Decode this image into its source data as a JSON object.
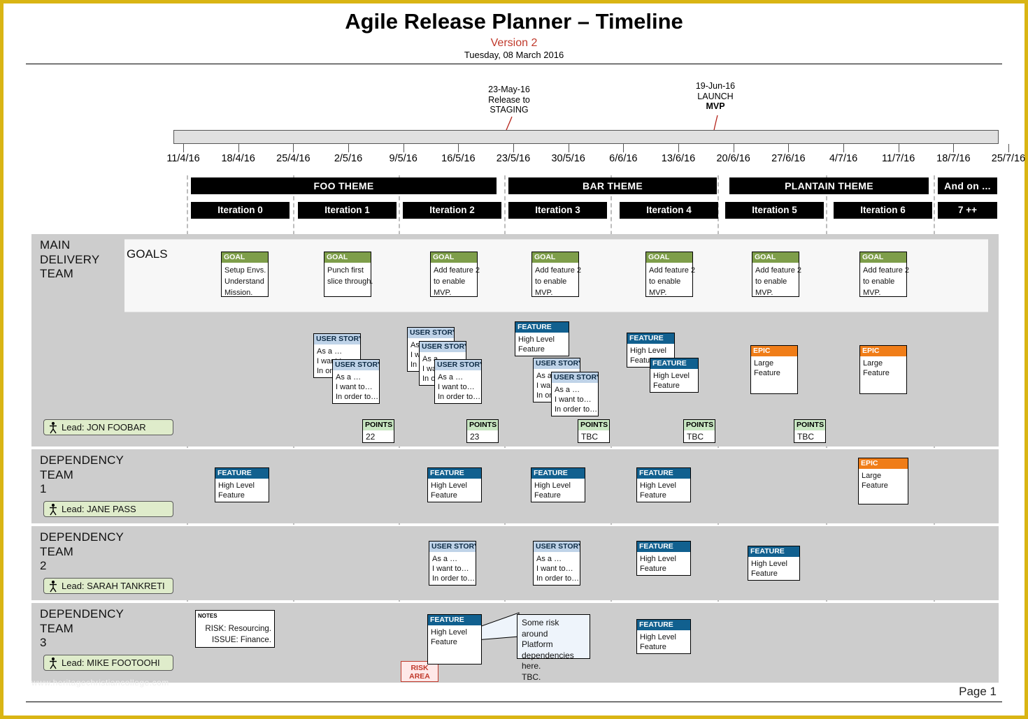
{
  "document": {
    "title": "Agile Release Planner – Timeline",
    "version": "Version 2",
    "date": "Tuesday, 08 March 2016",
    "page_label": "Page 1",
    "watermark": "www.heritagechristiancollege.com"
  },
  "milestones": [
    {
      "date": "23-May-16",
      "line2": "Release to",
      "line3": "STAGING",
      "marker": "arrow",
      "color": "#b5231a"
    },
    {
      "date": "19-Jun-16",
      "line2": "LAUNCH",
      "line3": "MVP",
      "marker": "cross",
      "color": "#b5231a"
    }
  ],
  "axis": {
    "ticks": [
      "11/4/16",
      "18/4/16",
      "25/4/16",
      "2/5/16",
      "9/5/16",
      "16/5/16",
      "23/5/16",
      "30/5/16",
      "6/6/16",
      "13/6/16",
      "20/6/16",
      "27/6/16",
      "4/7/16",
      "11/7/16",
      "18/7/16",
      "25/7/16"
    ]
  },
  "themes": [
    {
      "label": "FOO THEME"
    },
    {
      "label": "BAR THEME"
    },
    {
      "label": "PLANTAIN THEME"
    },
    {
      "label": "And on ..."
    }
  ],
  "iterations": [
    {
      "label": "Iteration 0"
    },
    {
      "label": "Iteration 1"
    },
    {
      "label": "Iteration 2"
    },
    {
      "label": "Iteration 3"
    },
    {
      "label": "Iteration 4"
    },
    {
      "label": "Iteration 5"
    },
    {
      "label": "Iteration 6"
    },
    {
      "label": "7 ++"
    }
  ],
  "lanes": [
    {
      "name": "MAIN\nDELIVERY\nTEAM",
      "line1": "MAIN",
      "line2": "DELIVERY",
      "line3": "TEAM",
      "lead": "Lead: JON FOOBAR"
    },
    {
      "name": "DEPENDENCY TEAM 1",
      "line1": "DEPENDENCY",
      "line2": "TEAM",
      "line3": "1",
      "lead": "Lead: JANE PASS"
    },
    {
      "name": "DEPENDENCY TEAM 2",
      "line1": "DEPENDENCY",
      "line2": "TEAM",
      "line3": "2",
      "lead": "Lead: SARAH TANKRETI"
    },
    {
      "name": "DEPENDENCY TEAM 3",
      "line1": "DEPENDENCY",
      "line2": "TEAM",
      "line3": "3",
      "lead": "Lead: MIKE FOOTOOHI"
    }
  ],
  "goals_label": "GOALS",
  "goals": [
    {
      "head": "GOAL",
      "lines": [
        "Setup Envs.",
        "Understand",
        "Mission."
      ]
    },
    {
      "head": "GOAL",
      "lines": [
        "Punch first",
        "slice through."
      ]
    },
    {
      "head": "GOAL",
      "lines": [
        "Add feature 2",
        "to enable",
        "MVP."
      ]
    },
    {
      "head": "GOAL",
      "lines": [
        "Add feature 2",
        "to enable",
        "MVP."
      ]
    },
    {
      "head": "GOAL",
      "lines": [
        "Add feature 2",
        "to enable",
        "MVP."
      ]
    },
    {
      "head": "GOAL",
      "lines": [
        "Add feature 2",
        "to enable",
        "MVP."
      ]
    },
    {
      "head": "GOAL",
      "lines": [
        "Add feature 2",
        "to enable",
        "MVP."
      ]
    }
  ],
  "card_heads": {
    "story": "USER STORY",
    "feature": "FEATURE",
    "epic": "EPIC",
    "points": "POINTS",
    "notes": "NOTES",
    "goal": "GOAL"
  },
  "card_bodies": {
    "story": [
      "As a …",
      "I want to…",
      "In order to…"
    ],
    "feature": [
      "High Level",
      "Feature"
    ],
    "epic": [
      "Large",
      "Feature"
    ]
  },
  "main_team_cards": [
    {
      "type": "story",
      "head": "USER STORY",
      "lines": [
        "As a …",
        "I want to…",
        "In order to…"
      ]
    },
    {
      "type": "story",
      "head": "USER STORY",
      "lines": [
        "As a …",
        "I want to…",
        "In order to…"
      ]
    },
    {
      "type": "story",
      "head": "USER STORY",
      "lines": [
        "As a …",
        "I want to…",
        "In order to…"
      ]
    },
    {
      "type": "story",
      "head": "USER STORY",
      "lines": [
        "As a …",
        "I want to…",
        "In order to…"
      ]
    },
    {
      "type": "story",
      "head": "USER STORY",
      "lines": [
        "As a …",
        "I want to…",
        "In order to…"
      ]
    },
    {
      "type": "feature",
      "head": "FEATURE",
      "lines": [
        "High Level",
        "Feature"
      ]
    },
    {
      "type": "story",
      "head": "USER STORY",
      "lines": [
        "As a …",
        "I want to…",
        "In order to…"
      ]
    },
    {
      "type": "story",
      "head": "USER STORY",
      "lines": [
        "As a …",
        "I want to…",
        "In order to…"
      ]
    },
    {
      "type": "feature",
      "head": "FEATURE",
      "lines": [
        "High Level",
        "Feature"
      ]
    },
    {
      "type": "feature",
      "head": "FEATURE",
      "lines": [
        "High Level",
        "Feature"
      ]
    },
    {
      "type": "epic",
      "head": "EPIC",
      "lines": [
        "Large",
        "Feature"
      ]
    },
    {
      "type": "epic",
      "head": "EPIC",
      "lines": [
        "Large",
        "Feature"
      ]
    }
  ],
  "points": [
    {
      "head": "POINTS",
      "value": "22",
      "iteration": "Iteration 1"
    },
    {
      "head": "POINTS",
      "value": "23",
      "iteration": "Iteration 2"
    },
    {
      "head": "POINTS",
      "value": "TBC",
      "iteration": "Iteration 3"
    },
    {
      "head": "POINTS",
      "value": "TBC",
      "iteration": "Iteration 4"
    },
    {
      "head": "POINTS",
      "value": "TBC",
      "iteration": "Iteration 5"
    }
  ],
  "dep1_cards": [
    {
      "type": "feature",
      "head": "FEATURE",
      "lines": [
        "High Level",
        "Feature"
      ]
    },
    {
      "type": "feature",
      "head": "FEATURE",
      "lines": [
        "High Level",
        "Feature"
      ]
    },
    {
      "type": "feature",
      "head": "FEATURE",
      "lines": [
        "High Level",
        "Feature"
      ]
    },
    {
      "type": "feature",
      "head": "FEATURE",
      "lines": [
        "High Level",
        "Feature"
      ]
    },
    {
      "type": "epic",
      "head": "EPIC",
      "lines": [
        "Large",
        "Feature"
      ]
    }
  ],
  "dep2_cards": [
    {
      "type": "story",
      "head": "USER STORY",
      "lines": [
        "As a …",
        "I want to…",
        "In order to…"
      ]
    },
    {
      "type": "story",
      "head": "USER STORY",
      "lines": [
        "As a …",
        "I want to…",
        "In order to…"
      ]
    },
    {
      "type": "feature",
      "head": "FEATURE",
      "lines": [
        "High Level",
        "Feature"
      ]
    },
    {
      "type": "feature",
      "head": "FEATURE",
      "lines": [
        "High Level",
        "Feature"
      ]
    }
  ],
  "dep3_cards": [
    {
      "type": "feature",
      "head": "FEATURE",
      "lines": [
        "High Level",
        "Feature"
      ]
    },
    {
      "type": "feature",
      "head": "FEATURE",
      "lines": [
        "High Level",
        "Feature"
      ]
    }
  ],
  "notes_card": {
    "head": "NOTES",
    "lines": [
      "RISK: Resourcing.",
      "ISSUE: Finance."
    ]
  },
  "risk_area": {
    "line1": "RISK",
    "line2": "AREA"
  },
  "callout": {
    "lines": [
      "Some risk around",
      "Platform",
      "dependencies here.",
      "TBC."
    ]
  },
  "colors": {
    "goal": "#7e9e4a",
    "story": "#bfd3e8",
    "feature": "#11608f",
    "epic": "#f07d18",
    "points": "#c8e6c2",
    "lane": "#cdcdcd",
    "lead": "#dfeccb",
    "milestone": "#b5231a",
    "page_border": "#d9b514",
    "version": "#c0392b"
  }
}
